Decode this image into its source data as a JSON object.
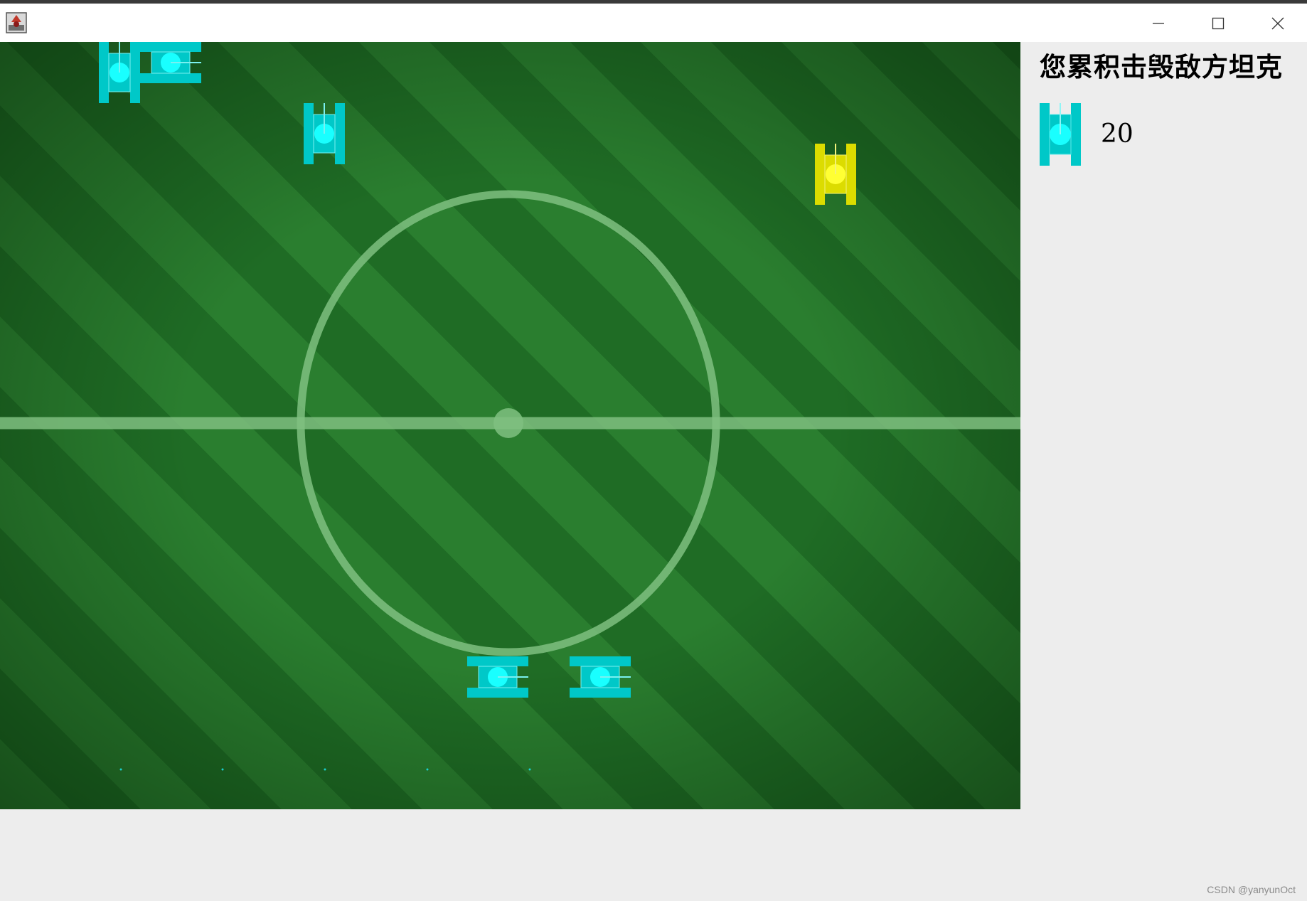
{
  "window": {
    "title": "",
    "icon": "java-app-icon",
    "controls": [
      "minimize-icon",
      "maximize-icon",
      "close-icon"
    ]
  },
  "field": {
    "background": "soccer-pitch",
    "grass_colors": [
      "#2a7e2f",
      "#1f6c25"
    ],
    "line_color": "#7fbf80",
    "tanks": [
      {
        "side": "enemy",
        "color": "#00c8c8",
        "direction": "up"
      },
      {
        "side": "enemy",
        "color": "#00c8c8",
        "direction": "right"
      },
      {
        "side": "enemy",
        "color": "#00c8c8",
        "direction": "up"
      },
      {
        "side": "player",
        "color": "#dcdc00",
        "direction": "up"
      },
      {
        "side": "enemy",
        "color": "#00c8c8",
        "direction": "right"
      },
      {
        "side": "enemy",
        "color": "#00c8c8",
        "direction": "right"
      }
    ]
  },
  "panel": {
    "title": "您累积击毁敌方坦克",
    "tank_icon_color": "#00c8c8",
    "kill_count": "20"
  },
  "watermark": "CSDN @yanyunOct"
}
